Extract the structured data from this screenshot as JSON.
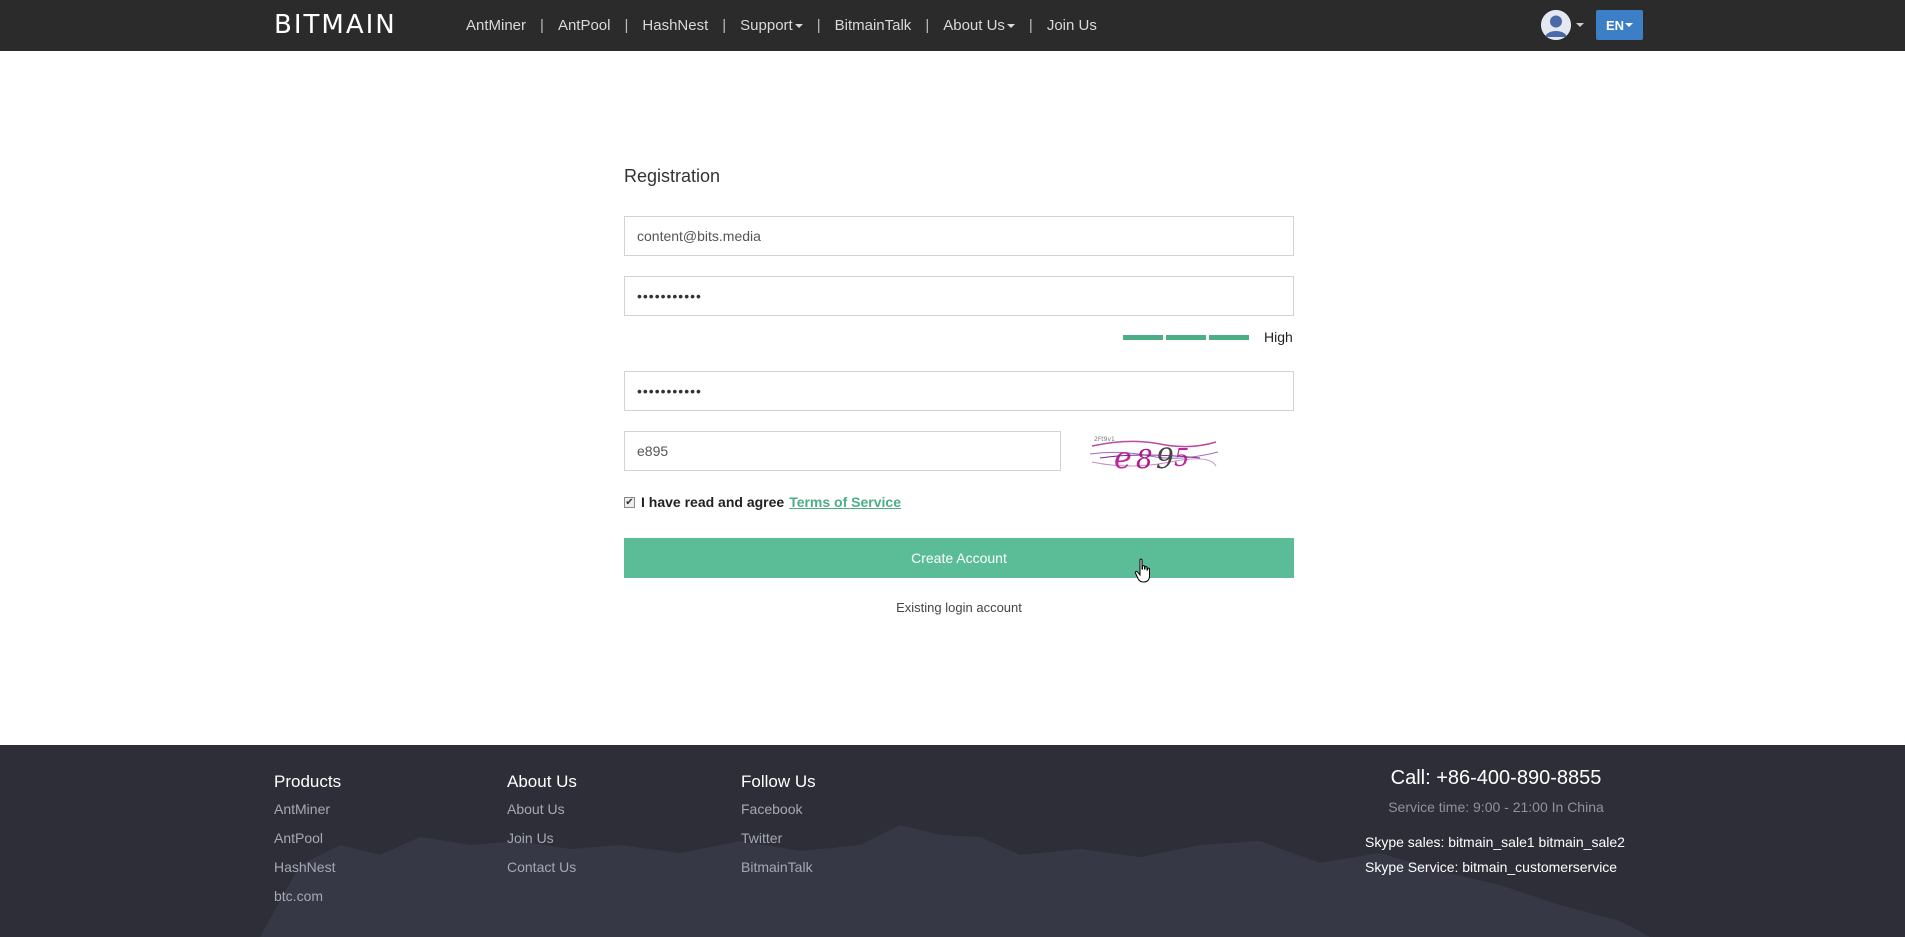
{
  "header": {
    "logo": "BITMAIN",
    "nav": [
      {
        "label": "AntMiner",
        "dropdown": false
      },
      {
        "label": "AntPool",
        "dropdown": false
      },
      {
        "label": "HashNest",
        "dropdown": false
      },
      {
        "label": "Support",
        "dropdown": true
      },
      {
        "label": "BitmainTalk",
        "dropdown": false
      },
      {
        "label": "About Us",
        "dropdown": true
      },
      {
        "label": "Join Us",
        "dropdown": false
      }
    ],
    "separator": "|",
    "lang_label": "EN",
    "accent": "#3d7fc6"
  },
  "form": {
    "title": "Registration",
    "email_value": "content@bits.media",
    "password_value": "•••••••••••",
    "strength": {
      "label": "High",
      "level": 3,
      "max": 3,
      "color": "#4cae87"
    },
    "confirm_value": "•••••••••••",
    "captcha_value": "e895",
    "agree_checked": true,
    "agree_text": "I have read and agree",
    "terms_label": "Terms of Service",
    "create_label": "Create Account",
    "existing_label": "Existing login account",
    "button_color": "#5bbc98"
  },
  "footer": {
    "columns": [
      {
        "title": "Products",
        "links": [
          "AntMiner",
          "AntPool",
          "HashNest",
          "btc.com"
        ]
      },
      {
        "title": "About Us",
        "links": [
          "About Us",
          "Join Us",
          "Contact Us"
        ]
      },
      {
        "title": "Follow Us",
        "links": [
          "Facebook",
          "Twitter",
          "BitmainTalk"
        ]
      }
    ],
    "call": "Call: +86-400-890-8855",
    "service_time": "Service time: 9:00 - 21:00 In China",
    "skype_sales": "Skype sales: bitmain_sale1 bitmain_sale2",
    "skype_service": "Skype Service: bitmain_customerservice"
  }
}
